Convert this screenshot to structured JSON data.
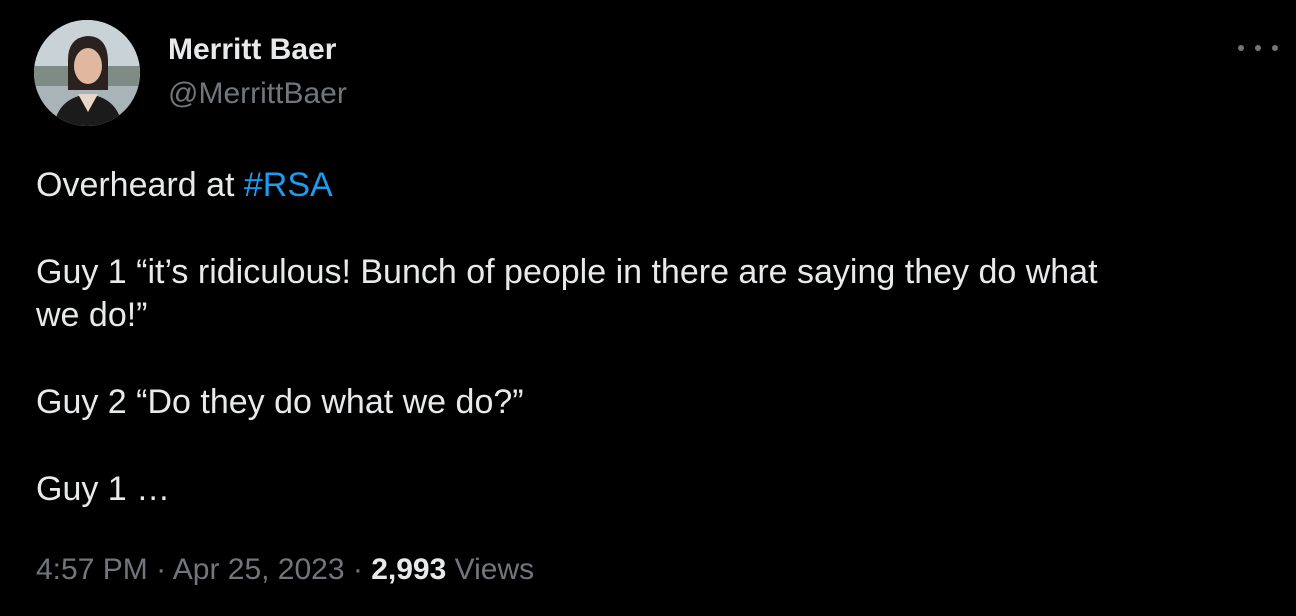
{
  "author": {
    "display_name": "Merritt Baer",
    "handle": "@MerrittBaer"
  },
  "tweet": {
    "line1_prefix": "Overheard at ",
    "hashtag": "#RSA",
    "line2": "Guy 1 “it’s ridiculous! Bunch of people in there are saying they do what",
    "line3": "we do!”",
    "line4": "Guy 2 “Do they do what we do?”",
    "line5": "Guy 1 …"
  },
  "meta": {
    "time": "4:57 PM",
    "separator": " · ",
    "date": "Apr 25, 2023",
    "views_count": "2,993",
    "views_label": "Views"
  },
  "colors": {
    "background": "#000000",
    "text": "#e7e9ea",
    "secondary": "#71767b",
    "link": "#1d9bf0"
  },
  "icons": {
    "more": "more-horizontal-icon",
    "avatar": "profile-photo"
  }
}
